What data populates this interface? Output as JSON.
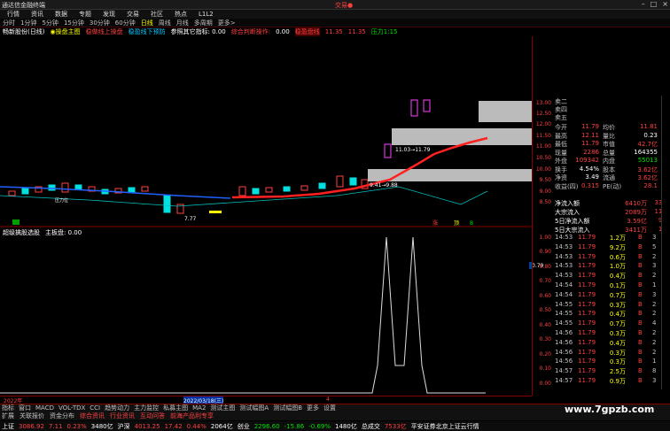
{
  "titlebar": {
    "app": "通达信金融终端",
    "current": "交易●"
  },
  "menu": [
    "行情",
    "资讯",
    "数据",
    "专题",
    "发现",
    "交易",
    "社区",
    "热点",
    "L1L2"
  ],
  "periods": [
    "分时",
    "1分钟",
    "5分钟",
    "15分钟",
    "30分钟",
    "60分钟",
    "日线",
    "周线",
    "月线",
    "多周期",
    "更多>"
  ],
  "indicator_bar": {
    "title": "畅新股份(日线)",
    "main": "◉操盘主图",
    "a": "稳做线上操盘",
    "b": "稳盈线下预防",
    "c": "参照其它指标: 0.00",
    "d": "综合判断操作:",
    "e": "0.00",
    "f": "稳盈盘线",
    "g": "11.35",
    "h": "11.35",
    "i": "压力1:15"
  },
  "chart_labels": {
    "range_label": "11.03→11.79",
    "low_label": "9.41→9.88",
    "low_marker": "7.77",
    "pressure": "压力位",
    "s1": "涨",
    "s2": "顶",
    "s3": "B"
  },
  "price_axis": [
    "13.00",
    "12.50",
    "12.00",
    "11.50",
    "11.00",
    "10.50",
    "10.00",
    "9.50",
    "9.00",
    "8.50"
  ],
  "sub_axis": [
    "1.00",
    "0.90",
    "0.80",
    "0.70",
    "0.60",
    "0.50",
    "0.40",
    "0.30",
    "0.20",
    "0.10",
    "0.00"
  ],
  "sub_header": {
    "name": "超级擒股选股",
    "line": "主板盘: 0.00",
    "value_tag": "0.79"
  },
  "order_book": [
    {
      "l": "卖二",
      "v": ""
    },
    {
      "l": "卖四",
      "v": ""
    },
    {
      "l": "卖五",
      "v": ""
    }
  ],
  "quote": [
    {
      "l": "今开",
      "v": "11.79",
      "l2": "均价",
      "v2": "11.81"
    },
    {
      "l": "最高",
      "v": "12.11",
      "l2": "量比",
      "v2": "0.23"
    },
    {
      "l": "最低",
      "v": "11.79",
      "l2": "市值",
      "v2": "42.7亿"
    },
    {
      "l": "现量",
      "v": "2286",
      "l2": "总量",
      "v2": "164355"
    },
    {
      "l": "外盘",
      "v": "109342",
      "l2": "内盘",
      "v2": "55013"
    },
    {
      "l": "换手",
      "v": "4.54%",
      "l2": "股本",
      "v2": "3.62亿"
    },
    {
      "l": "净资",
      "v": "3.49",
      "l2": "流通",
      "v2": "3.62亿"
    },
    {
      "l": "收益(四)",
      "v": "0.315",
      "l2": "PE(动)",
      "v2": "28.1"
    }
  ],
  "flows": [
    {
      "l": "净流入额",
      "v": "6410万",
      "p": "33%"
    },
    {
      "l": "大宗流入",
      "v": "2089万",
      "p": "11%"
    },
    {
      "l": "5日净流入额",
      "v": "3.59亿",
      "p": "9%"
    },
    {
      "l": "5日大宗流入",
      "v": "3411万",
      "p": "1%"
    }
  ],
  "ticks": [
    {
      "t": "14:53",
      "p": "11.79",
      "v": "1.2万",
      "b": "B",
      "n": "3"
    },
    {
      "t": "14:53",
      "p": "11.79",
      "v": "9.2万",
      "b": "B",
      "n": "5"
    },
    {
      "t": "14:53",
      "p": "11.79",
      "v": "0.6万",
      "b": "B",
      "n": "2"
    },
    {
      "t": "14:53",
      "p": "11.79",
      "v": "1.0万",
      "b": "B",
      "n": "3"
    },
    {
      "t": "14:53",
      "p": "11.79",
      "v": "0.4万",
      "b": "B",
      "n": "2"
    },
    {
      "t": "14:54",
      "p": "11.79",
      "v": "0.1万",
      "b": "B",
      "n": "1"
    },
    {
      "t": "14:54",
      "p": "11.79",
      "v": "0.7万",
      "b": "B",
      "n": "3"
    },
    {
      "t": "14:55",
      "p": "11.79",
      "v": "0.3万",
      "b": "B",
      "n": "2"
    },
    {
      "t": "14:55",
      "p": "11.79",
      "v": "0.4万",
      "b": "B",
      "n": "2"
    },
    {
      "t": "14:55",
      "p": "11.79",
      "v": "0.7万",
      "b": "B",
      "n": "4"
    },
    {
      "t": "14:56",
      "p": "11.79",
      "v": "0.3万",
      "b": "B",
      "n": "2"
    },
    {
      "t": "14:56",
      "p": "11.79",
      "v": "0.4万",
      "b": "B",
      "n": "2"
    },
    {
      "t": "14:56",
      "p": "11.79",
      "v": "0.3万",
      "b": "B",
      "n": "2"
    },
    {
      "t": "14:56",
      "p": "11.79",
      "v": "0.3万",
      "b": "B",
      "n": "1"
    },
    {
      "t": "14:57",
      "p": "11.79",
      "v": "2.5万",
      "b": "B",
      "n": "8"
    },
    {
      "t": "14:57",
      "p": "11.79",
      "v": "0.9万",
      "b": "B",
      "n": "3"
    }
  ],
  "time_axis": {
    "left": "2022年",
    "mid": "2022/03/18(三)",
    "mark": "4"
  },
  "tabs": [
    "指标",
    "窗口",
    "MACD",
    "VOL-TDX",
    "CCI",
    "趋势动力",
    "主力监控",
    "私募主图",
    "MA2",
    "测试主图",
    "测试幅图A",
    "测试幅图B",
    "更多",
    "设置"
  ],
  "tabs2": [
    "扩展",
    "关联报价",
    "资金分布",
    "综合资讯",
    "行业资讯",
    "互动问答",
    "前海产品利专享"
  ],
  "status": [
    {
      "k": "上证",
      "v": "3086.92",
      "c": "7.11",
      "p": "0.23%",
      "a": "3480亿"
    },
    {
      "k": "沪深",
      "v": "4013.25",
      "c": "17.42",
      "p": "0.44%",
      "a": "2064亿"
    },
    {
      "k": "创业",
      "v": "2296.60",
      "c": "-15.86",
      "p": "-0.69%",
      "a": "1480亿"
    },
    {
      "k": "总成交",
      "v": "7533亿",
      "c": "",
      "p": "",
      "a": ""
    }
  ],
  "status_tail": "平安证券北京上证云行情",
  "watermark": "www.7gpzb.com",
  "colors": {
    "up": "#ff4040",
    "down": "#00e0e0",
    "ma": "#ff2020",
    "pink": "#ff40ff"
  }
}
